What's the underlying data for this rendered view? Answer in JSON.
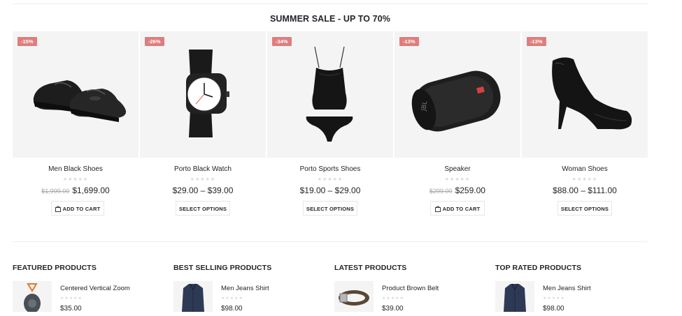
{
  "sale": {
    "title": "SUMMER SALE - UP TO 70%"
  },
  "products": [
    {
      "name": "Men Black Shoes",
      "badge": "-15%",
      "old_price": "$1,999.00",
      "price": "$1,699.00",
      "button": "ADD TO CART"
    },
    {
      "name": "Porto Black Watch",
      "badge": "-26%",
      "old_price": "",
      "price": "$29.00 – $39.00",
      "button": "SELECT OPTIONS"
    },
    {
      "name": "Porto Sports Shoes",
      "badge": "-34%",
      "old_price": "",
      "price": "$19.00 – $29.00",
      "button": "SELECT OPTIONS"
    },
    {
      "name": "Speaker",
      "badge": "-13%",
      "old_price": "$299.00",
      "price": "$259.00",
      "button": "ADD TO CART"
    },
    {
      "name": "Woman Shoes",
      "badge": "-13%",
      "old_price": "",
      "price": "$88.00 – $111.00",
      "button": "SELECT OPTIONS"
    }
  ],
  "stars_glyph": "★★★★★",
  "lists": [
    {
      "title": "FEATURED PRODUCTS",
      "item_name": "Centered Vertical Zoom",
      "item_price": "$35.00",
      "thumb": "speaker-icon"
    },
    {
      "title": "BEST SELLING PRODUCTS",
      "item_name": "Men Jeans Shirt",
      "item_price": "$98.00",
      "thumb": "shirt-icon"
    },
    {
      "title": "LATEST PRODUCTS",
      "item_name": "Product Brown Belt",
      "item_price": "$39.00",
      "thumb": "belt-icon"
    },
    {
      "title": "TOP RATED PRODUCTS",
      "item_name": "Men Jeans Shirt",
      "item_price": "$98.00",
      "thumb": "shirt-icon"
    }
  ],
  "colors": {
    "badge": "#e27c7c",
    "card_bg": "#f4f4f4",
    "text": "#222529",
    "muted": "#a7a7a7"
  }
}
